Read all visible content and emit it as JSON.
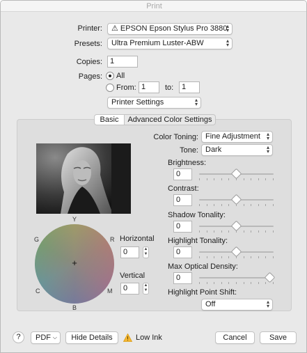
{
  "window": {
    "title": "Print"
  },
  "printer": {
    "label": "Printer:",
    "value": "⚠ EPSON Epson Stylus Pro 3880"
  },
  "presets": {
    "label": "Presets:",
    "value": "Ultra Premium Luster-ABW"
  },
  "copies": {
    "label": "Copies:",
    "value": "1"
  },
  "pages": {
    "label": "Pages:",
    "all_label": "All",
    "from_label": "From:",
    "from_value": "1",
    "to_label": "to:",
    "to_value": "1",
    "selected": "All"
  },
  "section": {
    "value": "Printer Settings"
  },
  "tabs": [
    {
      "label": "Basic",
      "selected": true
    },
    {
      "label": "Advanced Color Settings",
      "selected": false
    }
  ],
  "color_toning": {
    "label": "Color Toning:",
    "value": "Fine Adjustment"
  },
  "tone": {
    "label": "Tone:",
    "value": "Dark"
  },
  "sliders": [
    {
      "label": "Brightness:",
      "value": "0",
      "level": 0.5
    },
    {
      "label": "Contrast:",
      "value": "0",
      "level": 0.5
    },
    {
      "label": "Shadow Tonality:",
      "value": "0",
      "level": 0.5
    },
    {
      "label": "Highlight Tonality:",
      "value": "0",
      "level": 0.5
    },
    {
      "label": "Max Optical Density:",
      "value": "0",
      "level": 1.0
    }
  ],
  "highlight_point_shift": {
    "label": "Highlight Point Shift:",
    "value": "Off"
  },
  "color_wheel": {
    "labels": {
      "top": "Y",
      "top_right": "R",
      "bottom_right": "M",
      "bottom": "B",
      "bottom_left": "C",
      "top_left": "G"
    }
  },
  "horizontal": {
    "label": "Horizontal",
    "value": "0"
  },
  "vertical": {
    "label": "Vertical",
    "value": "0"
  },
  "footer": {
    "help": "?",
    "pdf": "PDF",
    "hide_details": "Hide Details",
    "warning": "Low Ink",
    "cancel": "Cancel",
    "save": "Save"
  }
}
